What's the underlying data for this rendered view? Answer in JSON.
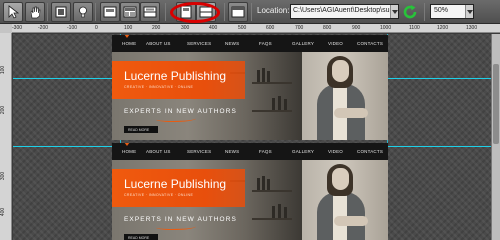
{
  "toolbar": {
    "location_label": "Location:",
    "location_value": "C:\\Users\\AGIAuent\\Desktop\\superp",
    "zoom_value": "50%",
    "highlight_color": "#d90000"
  },
  "ruler": {
    "h_ticks": [
      "-300",
      "-200",
      "-100",
      "0",
      "100",
      "200",
      "300",
      "400",
      "500",
      "600",
      "700",
      "800",
      "900",
      "1000",
      "1100",
      "1200",
      "1300"
    ],
    "v_ticks": [
      "100",
      "200",
      "300",
      "400"
    ]
  },
  "page_preview": {
    "nav": [
      "HOME",
      "ABOUT US",
      "SERVICES",
      "NEWS",
      "FAQS",
      "GALLERY",
      "VIDEO",
      "CONTACTS"
    ],
    "brand": "Lucerne Publishing",
    "tagline": "CREATIVE · INNOVATIVE · ONLINE",
    "headline": "EXPERTS IN NEW AUTHORS",
    "read_more": "READ MORE",
    "accent_color": "#e85c12"
  }
}
